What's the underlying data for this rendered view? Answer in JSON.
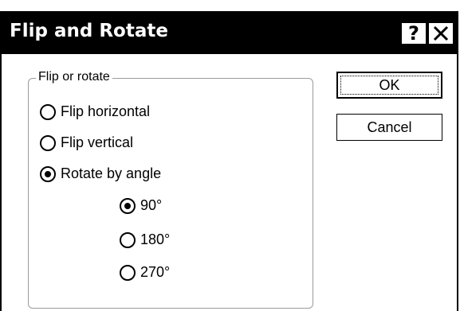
{
  "window": {
    "title": "Flip and Rotate",
    "help_glyph": "?"
  },
  "group": {
    "label": "Flip or rotate",
    "options": [
      {
        "label": "Flip horizontal",
        "checked": false
      },
      {
        "label": "Flip vertical",
        "checked": false
      },
      {
        "label": "Rotate by angle",
        "checked": true
      }
    ],
    "angles": [
      {
        "label": "90°",
        "checked": true
      },
      {
        "label": "180°",
        "checked": false
      },
      {
        "label": "270°",
        "checked": false
      }
    ]
  },
  "buttons": {
    "ok_label": "OK",
    "cancel_label": "Cancel"
  }
}
